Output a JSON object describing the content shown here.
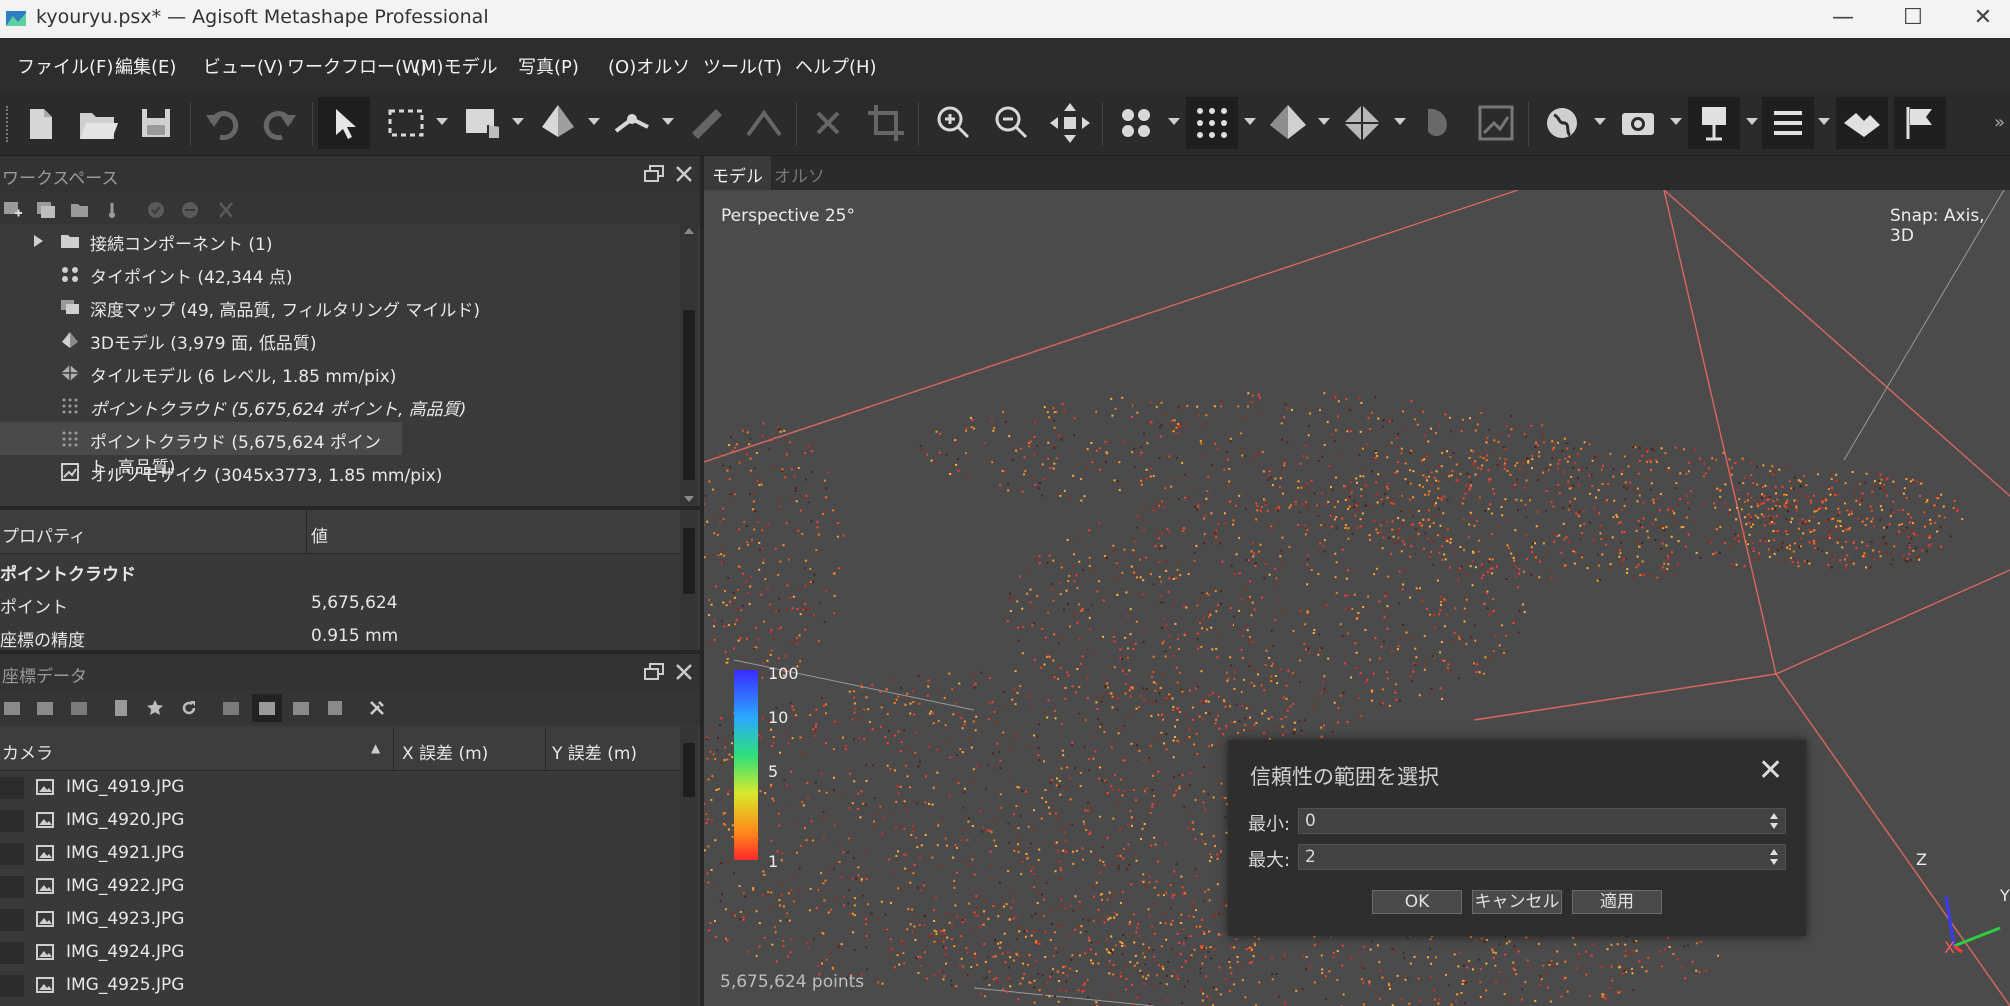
{
  "window": {
    "title": "kyouryu.psx* — Agisoft Metashape Professional",
    "minimize": "—",
    "maximize": "☐",
    "close": "✕"
  },
  "menu": [
    "ファイル(F)",
    "編集(E)",
    "ビュー(V)",
    "ワークフロー(W)",
    "(M)モデル",
    "写真(P)",
    "(O)オルソ",
    "ツール(T)",
    "ヘルプ(H)"
  ],
  "workspace": {
    "title": "ワークスペース",
    "items": [
      {
        "label": "接続コンポーネント (1)",
        "italic": false,
        "icon": "folder-icon"
      },
      {
        "label": "タイポイント (42,344 点)",
        "italic": false,
        "icon": "tie-points-icon"
      },
      {
        "label": "深度マップ (49, 高品質, フィルタリング マイルド)",
        "italic": false,
        "icon": "depth-maps-icon"
      },
      {
        "label": "3Dモデル (3,979 面, 低品質)",
        "italic": false,
        "icon": "model-icon"
      },
      {
        "label": "タイルモデル (6 レベル, 1.85 mm/pix)",
        "italic": false,
        "icon": "tiled-model-icon"
      },
      {
        "label": "ポイントクラウド (5,675,624 ポイント, 高品質)",
        "italic": true,
        "icon": "point-cloud-icon"
      },
      {
        "label": "ポイントクラウド (5,675,624 ポイント, 高品質)",
        "italic": false,
        "icon": "point-cloud-icon"
      },
      {
        "label": "オルソモザイク (3045x3773, 1.85 mm/pix)",
        "italic": false,
        "icon": "orthomosaic-icon"
      }
    ]
  },
  "properties": {
    "col_property": "プロパティ",
    "col_value": "値",
    "section": "ポイントクラウド",
    "rows": [
      {
        "name": "ポイント",
        "value": "5,675,624"
      },
      {
        "name": "座標の精度",
        "value": "0.915 mm"
      }
    ]
  },
  "reference": {
    "title": "座標データ",
    "columns": [
      "カメラ",
      "X 誤差 (m)",
      "Y 誤差 (m)"
    ],
    "cameras": [
      "IMG_4919.JPG",
      "IMG_4920.JPG",
      "IMG_4921.JPG",
      "IMG_4922.JPG",
      "IMG_4923.JPG",
      "IMG_4924.JPG",
      "IMG_4925.JPG"
    ]
  },
  "view": {
    "tabs": [
      "モデル",
      "オルソ"
    ],
    "active_tab": "モデル",
    "perspective": "Perspective 25°",
    "snap": "Snap: Axis, 3D",
    "points_count": "5,675,624 points",
    "legend_ticks": [
      "100",
      "10",
      "5",
      "1"
    ],
    "axis_labels": {
      "x": "X",
      "y": "Y",
      "z": "Z"
    }
  },
  "dialog": {
    "title": "信頼性の範囲を選択",
    "close": "✕",
    "min_label": "最小:",
    "min_value": "0",
    "max_label": "最大:",
    "max_value": "2",
    "ok": "OK",
    "cancel": "キャンセル",
    "apply": "適用"
  },
  "colors": {
    "accent": "#2f9bd8",
    "panel_bg": "#3a3a3a",
    "viewport_bg": "#4b4b4b",
    "bbox_line": "#d9675f"
  }
}
